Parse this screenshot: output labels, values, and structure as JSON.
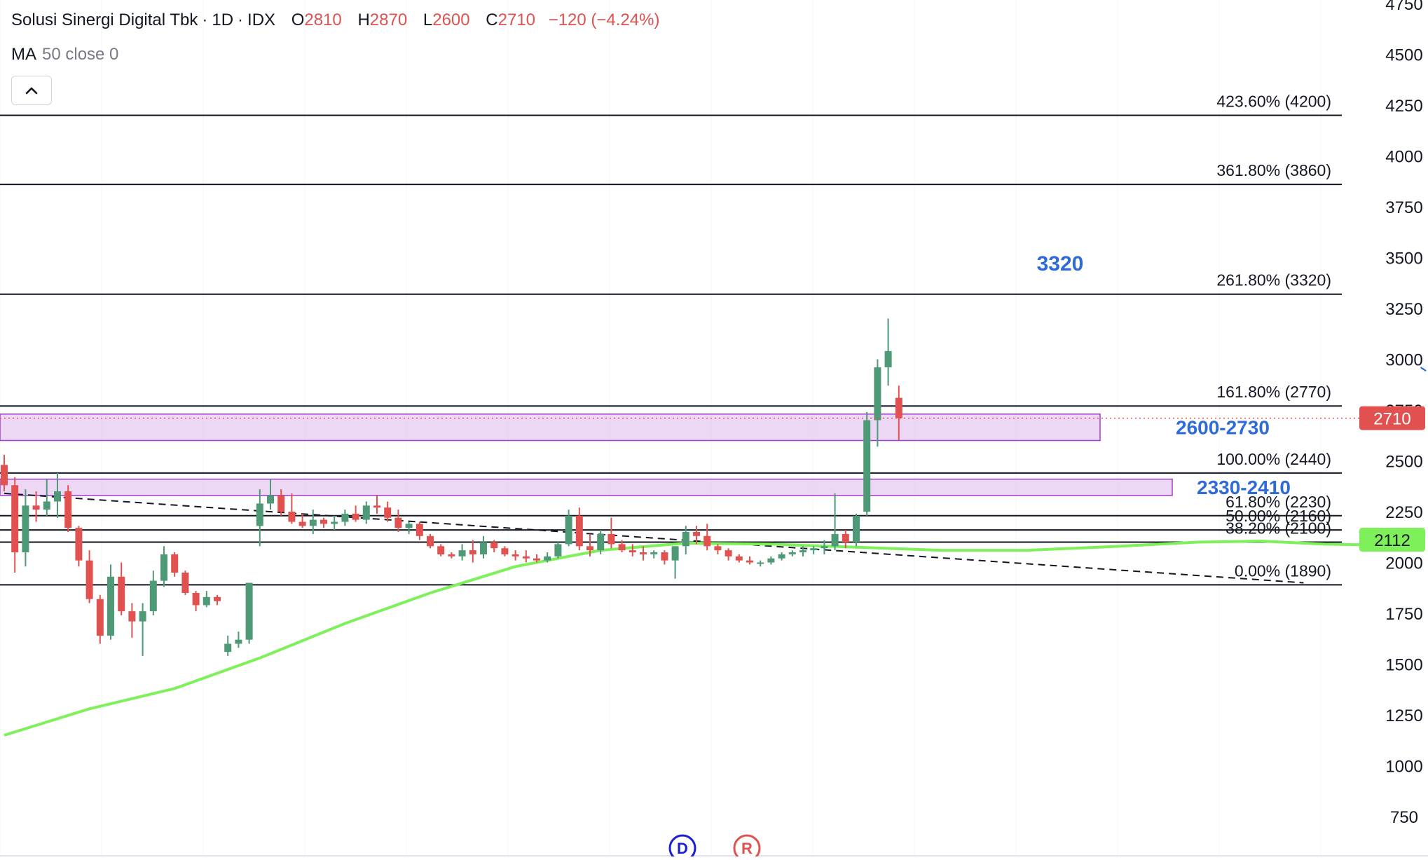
{
  "header": {
    "symbol": "Solusi Sinergi Digital Tbk",
    "interval": "1D",
    "exchange": "IDX",
    "separator": "·",
    "open_label": "O",
    "open": "2810",
    "high_label": "H",
    "high": "2870",
    "low_label": "L",
    "low": "2600",
    "close_label": "C",
    "close": "2710",
    "change": "−120 (−4.24%)"
  },
  "indicator": {
    "name": "MA",
    "params": "50 close 0"
  },
  "icons": {
    "collapse": "chevron-up-icon"
  },
  "colors": {
    "up": "#4e9a77",
    "down": "#e0514f",
    "ma": "#7ef05a",
    "zone": "#e6c9f1",
    "zone_border": "#a13bc9",
    "annotation": "#2f6bd8",
    "badge_price": "#e0514f",
    "badge_ma": "#7ef05a"
  },
  "chart_data": {
    "type": "candlestick",
    "y_axis": {
      "min": 750,
      "max": 4750,
      "ticks": [
        750,
        1000,
        1250,
        1500,
        1750,
        2000,
        2250,
        2500,
        2750,
        3000,
        3250,
        3500,
        3750,
        4000,
        4250,
        4500,
        4750
      ]
    },
    "candles": [
      [
        2480,
        2530,
        2350,
        2380
      ],
      [
        2380,
        2420,
        1950,
        2050
      ],
      [
        2050,
        2360,
        1980,
        2280
      ],
      [
        2280,
        2350,
        2200,
        2260
      ],
      [
        2260,
        2410,
        2230,
        2300
      ],
      [
        2300,
        2440,
        2220,
        2350
      ],
      [
        2350,
        2380,
        2150,
        2170
      ],
      [
        2170,
        2180,
        1980,
        2010
      ],
      [
        2010,
        2060,
        1800,
        1820
      ],
      [
        1820,
        1840,
        1600,
        1640
      ],
      [
        1640,
        1990,
        1620,
        1930
      ],
      [
        1930,
        2000,
        1740,
        1760
      ],
      [
        1760,
        1800,
        1630,
        1710
      ],
      [
        1710,
        1800,
        1540,
        1760
      ],
      [
        1760,
        1960,
        1740,
        1910
      ],
      [
        1910,
        2080,
        1880,
        2040
      ],
      [
        2040,
        2050,
        1930,
        1950
      ],
      [
        1950,
        1960,
        1840,
        1850
      ],
      [
        1850,
        1860,
        1760,
        1790
      ],
      [
        1790,
        1860,
        1780,
        1830
      ],
      [
        1830,
        1840,
        1790,
        1810
      ],
      [
        1560,
        1640,
        1540,
        1600
      ],
      [
        1600,
        1660,
        1580,
        1620
      ],
      [
        1620,
        1900,
        1600,
        1900
      ],
      [
        2180,
        2360,
        2080,
        2290
      ],
      [
        2290,
        2410,
        2260,
        2330
      ],
      [
        2330,
        2360,
        2230,
        2250
      ],
      [
        2250,
        2340,
        2190,
        2200
      ],
      [
        2200,
        2240,
        2170,
        2180
      ],
      [
        2180,
        2260,
        2140,
        2210
      ],
      [
        2210,
        2220,
        2170,
        2190
      ],
      [
        2190,
        2230,
        2160,
        2200
      ],
      [
        2200,
        2260,
        2180,
        2240
      ],
      [
        2240,
        2280,
        2200,
        2210
      ],
      [
        2210,
        2300,
        2190,
        2280
      ],
      [
        2280,
        2330,
        2240,
        2270
      ],
      [
        2270,
        2300,
        2200,
        2220
      ],
      [
        2220,
        2260,
        2150,
        2170
      ],
      [
        2170,
        2200,
        2140,
        2190
      ],
      [
        2190,
        2200,
        2110,
        2130
      ],
      [
        2130,
        2140,
        2070,
        2080
      ],
      [
        2080,
        2090,
        2030,
        2040
      ],
      [
        2040,
        2050,
        2020,
        2030
      ],
      [
        2030,
        2090,
        2010,
        2060
      ],
      [
        2060,
        2110,
        2000,
        2040
      ],
      [
        2040,
        2130,
        2020,
        2100
      ],
      [
        2100,
        2110,
        2050,
        2070
      ],
      [
        2070,
        2080,
        2030,
        2040
      ],
      [
        2040,
        2060,
        2010,
        2030
      ],
      [
        2030,
        2060,
        2000,
        2020
      ],
      [
        2020,
        2040,
        2000,
        2010
      ],
      [
        2010,
        2050,
        2000,
        2030
      ],
      [
        2030,
        2100,
        2020,
        2090
      ],
      [
        2090,
        2260,
        2080,
        2230
      ],
      [
        2230,
        2270,
        2060,
        2080
      ],
      [
        2080,
        2140,
        2030,
        2060
      ],
      [
        2060,
        2160,
        2040,
        2140
      ],
      [
        2140,
        2220,
        2070,
        2090
      ],
      [
        2090,
        2110,
        2050,
        2060
      ],
      [
        2060,
        2090,
        2030,
        2050
      ],
      [
        2050,
        2080,
        2010,
        2040
      ],
      [
        2040,
        2060,
        2020,
        2050
      ],
      [
        2050,
        2060,
        1990,
        2010
      ],
      [
        2010,
        2080,
        1920,
        2080
      ],
      [
        2080,
        2180,
        2040,
        2150
      ],
      [
        2150,
        2180,
        2090,
        2130
      ],
      [
        2130,
        2190,
        2060,
        2080
      ],
      [
        2080,
        2090,
        2040,
        2060
      ],
      [
        2060,
        2070,
        2010,
        2030
      ],
      [
        2030,
        2040,
        2000,
        2010
      ],
      [
        2010,
        2030,
        1990,
        2000
      ],
      [
        2000,
        2010,
        1980,
        2000
      ],
      [
        2000,
        2030,
        1990,
        2020
      ],
      [
        2020,
        2050,
        2010,
        2040
      ],
      [
        2040,
        2060,
        2030,
        2050
      ],
      [
        2050,
        2080,
        2030,
        2060
      ],
      [
        2060,
        2080,
        2040,
        2070
      ],
      [
        2070,
        2110,
        2040,
        2080
      ],
      [
        2080,
        2340,
        2060,
        2140
      ],
      [
        2140,
        2160,
        2070,
        2100
      ],
      [
        2100,
        2240,
        2080,
        2230
      ],
      [
        2250,
        2740,
        2230,
        2700
      ],
      [
        2700,
        3000,
        2570,
        2960
      ],
      [
        2960,
        3200,
        2870,
        3040
      ],
      [
        2810,
        2870,
        2600,
        2710
      ]
    ],
    "ma_series": [
      [
        0,
        1150
      ],
      [
        8,
        1280
      ],
      [
        16,
        1380
      ],
      [
        24,
        1530
      ],
      [
        32,
        1700
      ],
      [
        40,
        1850
      ],
      [
        48,
        1980
      ],
      [
        56,
        2060
      ],
      [
        64,
        2095
      ],
      [
        72,
        2090
      ],
      [
        80,
        2075
      ],
      [
        88,
        2060
      ],
      [
        96,
        2060
      ],
      [
        104,
        2078
      ],
      [
        112,
        2100
      ],
      [
        118,
        2105
      ],
      [
        124,
        2090
      ],
      [
        130,
        2085
      ],
      [
        133,
        2112
      ]
    ],
    "fib_levels": [
      {
        "label": "423.60% (4200)",
        "price": 4200
      },
      {
        "label": "361.80% (3860)",
        "price": 3860
      },
      {
        "label": "261.80% (3320)",
        "price": 3320
      },
      {
        "label": "161.80% (2770)",
        "price": 2770
      },
      {
        "label": "100.00% (2440)",
        "price": 2440
      },
      {
        "label": "61.80% (2230)",
        "price": 2230
      },
      {
        "label": "50.00% (2160)",
        "price": 2160
      },
      {
        "label": "38.20% (2100)",
        "price": 2100
      },
      {
        "label": "0.00% (1890)",
        "price": 1890
      }
    ],
    "zones": [
      {
        "label": "2600-2730",
        "low": 2600,
        "high": 2730
      },
      {
        "label": "2330-2410",
        "low": 2330,
        "high": 2410
      }
    ],
    "target_label": "3320",
    "projection": [
      [
        133,
        2960
      ],
      [
        142,
        2640
      ],
      [
        162,
        3320
      ]
    ],
    "trendline": [
      [
        0,
        2340
      ],
      [
        122,
        1900
      ]
    ],
    "price_badge": "2710",
    "ma_badge": "2112",
    "markers": [
      "D",
      "R"
    ]
  }
}
